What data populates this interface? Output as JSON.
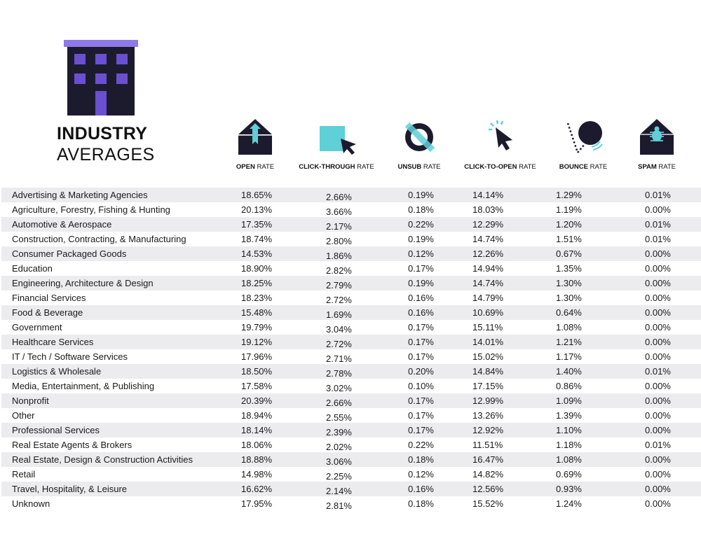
{
  "header": {
    "title_bold": "INDUSTRY",
    "title_light": "AVERAGES",
    "logo_icon": "building-icon"
  },
  "colors": {
    "navy": "#1c1b2e",
    "purple": "#6a4fd0",
    "roof_purple": "#8f79e8",
    "teal": "#5fcfd8",
    "row_shade": "#ececee"
  },
  "columns": [
    {
      "key": "open",
      "bold": "OPEN",
      "light": "RATE",
      "icon": "open-envelope-icon"
    },
    {
      "key": "ctr",
      "bold": "CLICK-THROUGH",
      "light": "RATE",
      "icon": "click-through-cursor-icon"
    },
    {
      "key": "unsub",
      "bold": "UNSUB",
      "light": "RATE",
      "icon": "unsubscribe-icon"
    },
    {
      "key": "cto",
      "bold": "CLICK-TO-OPEN",
      "light": "RATE",
      "icon": "click-cursor-icon"
    },
    {
      "key": "bounce",
      "bold": "BOUNCE",
      "light": "RATE",
      "icon": "bouncing-ball-icon"
    },
    {
      "key": "spam",
      "bold": "SPAM",
      "light": "RATE",
      "icon": "spam-bug-envelope-icon"
    }
  ],
  "rows": [
    {
      "industry": "Advertising & Marketing Agencies",
      "open": "18.65%",
      "ctr": "2.66%",
      "unsub": "0.19%",
      "cto": "14.14%",
      "bounce": "1.29%",
      "spam": "0.01%"
    },
    {
      "industry": "Agriculture, Forestry, Fishing & Hunting",
      "open": "20.13%",
      "ctr": "3.66%",
      "unsub": "0.18%",
      "cto": "18.03%",
      "bounce": "1.19%",
      "spam": "0.00%"
    },
    {
      "industry": "Automotive & Aerospace",
      "open": "17.35%",
      "ctr": "2.17%",
      "unsub": "0.22%",
      "cto": "12.29%",
      "bounce": "1.20%",
      "spam": "0.01%"
    },
    {
      "industry": "Construction, Contracting, & Manufacturing",
      "open": "18.74%",
      "ctr": "2.80%",
      "unsub": "0.19%",
      "cto": "14.74%",
      "bounce": "1.51%",
      "spam": "0.01%"
    },
    {
      "industry": "Consumer Packaged Goods",
      "open": "14.53%",
      "ctr": "1.86%",
      "unsub": "0.12%",
      "cto": "12.26%",
      "bounce": "0.67%",
      "spam": "0.00%"
    },
    {
      "industry": "Education",
      "open": "18.90%",
      "ctr": "2.82%",
      "unsub": "0.17%",
      "cto": "14.94%",
      "bounce": "1.35%",
      "spam": "0.00%"
    },
    {
      "industry": "Engineering, Architecture & Design",
      "open": "18.25%",
      "ctr": "2.79%",
      "unsub": "0.19%",
      "cto": "14.74%",
      "bounce": "1.30%",
      "spam": "0.00%"
    },
    {
      "industry": "Financial Services",
      "open": "18.23%",
      "ctr": "2.72%",
      "unsub": "0.16%",
      "cto": "14.79%",
      "bounce": "1.30%",
      "spam": "0.00%"
    },
    {
      "industry": "Food & Beverage",
      "open": "15.48%",
      "ctr": "1.69%",
      "unsub": "0.16%",
      "cto": "10.69%",
      "bounce": "0.64%",
      "spam": "0.00%"
    },
    {
      "industry": "Government",
      "open": "19.79%",
      "ctr": "3.04%",
      "unsub": "0.17%",
      "cto": "15.11%",
      "bounce": "1.08%",
      "spam": "0.00%"
    },
    {
      "industry": "Healthcare Services",
      "open": "19.12%",
      "ctr": "2.72%",
      "unsub": "0.17%",
      "cto": "14.01%",
      "bounce": "1.21%",
      "spam": "0.00%"
    },
    {
      "industry": "IT / Tech / Software Services",
      "open": "17.96%",
      "ctr": "2.71%",
      "unsub": "0.17%",
      "cto": "15.02%",
      "bounce": "1.17%",
      "spam": "0.00%"
    },
    {
      "industry": "Logistics & Wholesale",
      "open": "18.50%",
      "ctr": "2.78%",
      "unsub": "0.20%",
      "cto": "14.84%",
      "bounce": "1.40%",
      "spam": "0.01%"
    },
    {
      "industry": "Media, Entertainment, & Publishing",
      "open": "17.58%",
      "ctr": "3.02%",
      "unsub": "0.10%",
      "cto": "17.15%",
      "bounce": "0.86%",
      "spam": "0.00%"
    },
    {
      "industry": "Nonprofit",
      "open": "20.39%",
      "ctr": "2.66%",
      "unsub": "0.17%",
      "cto": "12.99%",
      "bounce": "1.09%",
      "spam": "0.00%"
    },
    {
      "industry": "Other",
      "open": "18.94%",
      "ctr": "2.55%",
      "unsub": "0.17%",
      "cto": "13.26%",
      "bounce": "1.39%",
      "spam": "0.00%"
    },
    {
      "industry": "Professional Services",
      "open": "18.14%",
      "ctr": "2.39%",
      "unsub": "0.17%",
      "cto": "12.92%",
      "bounce": "1.10%",
      "spam": "0.00%"
    },
    {
      "industry": "Real Estate Agents & Brokers",
      "open": "18.06%",
      "ctr": "2.02%",
      "unsub": "0.22%",
      "cto": "11.51%",
      "bounce": "1.18%",
      "spam": "0.01%"
    },
    {
      "industry": "Real Estate, Design & Construction Activities",
      "open": "18.88%",
      "ctr": "3.06%",
      "unsub": "0.18%",
      "cto": "16.47%",
      "bounce": "1.08%",
      "spam": "0.00%"
    },
    {
      "industry": "Retail",
      "open": "14.98%",
      "ctr": "2.25%",
      "unsub": "0.12%",
      "cto": "14.82%",
      "bounce": "0.69%",
      "spam": "0.00%"
    },
    {
      "industry": "Travel, Hospitality, & Leisure",
      "open": "16.62%",
      "ctr": "2.14%",
      "unsub": "0.16%",
      "cto": "12.56%",
      "bounce": "0.93%",
      "spam": "0.00%"
    },
    {
      "industry": "Unknown",
      "open": "17.95%",
      "ctr": "2.81%",
      "unsub": "0.18%",
      "cto": "15.52%",
      "bounce": "1.24%",
      "spam": "0.00%"
    }
  ]
}
